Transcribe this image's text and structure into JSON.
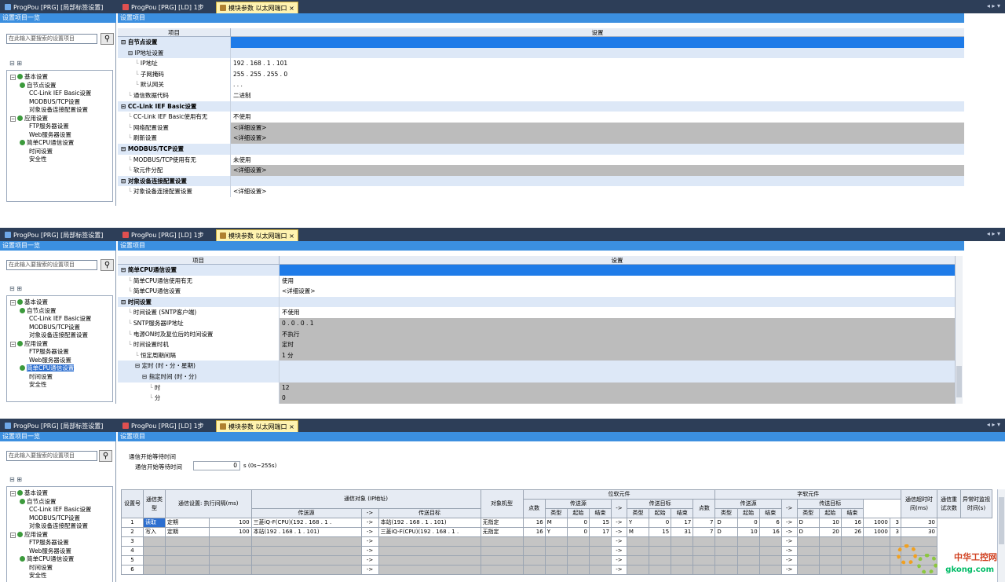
{
  "tabs": [
    {
      "label": "ProgPou [PRG] [局部标签设置]",
      "active": false
    },
    {
      "label": "ProgPou [PRG] [LD] 1步",
      "active": false
    },
    {
      "label": "模块参数 以太网端口",
      "active": true
    }
  ],
  "close_glyph": "×",
  "tab_controls": "◂ ▸ ▾",
  "left_header": "设置项目一览",
  "right_header": "设置项目",
  "search_placeholder": "在此输入要搜索的设置项目",
  "search_icon": "binoculars-icon",
  "toolbar_icons": "⊟ ⊞",
  "col_item": "项目",
  "col_setting": "设置",
  "tree": [
    {
      "label": "基本设置",
      "level": 0,
      "check": true,
      "expand": true
    },
    {
      "label": "自节点设置",
      "level": 1,
      "check": true
    },
    {
      "label": "CC-Link IEF Basic设置",
      "level": 2,
      "check": false
    },
    {
      "label": "MODBUS/TCP设置",
      "level": 2,
      "check": false
    },
    {
      "label": "对象设备连接配置设置",
      "level": 2,
      "check": false
    },
    {
      "label": "应用设置",
      "level": 0,
      "check": true,
      "expand": true
    },
    {
      "label": "FTP服务器设置",
      "level": 2,
      "check": false
    },
    {
      "label": "Web服务器设置",
      "level": 2,
      "check": false
    },
    {
      "label": "简单CPU通信设置",
      "level": 1,
      "check": true
    },
    {
      "label": "时间设置",
      "level": 2,
      "check": false
    },
    {
      "label": "安全性",
      "level": 2,
      "check": false
    }
  ],
  "panel1_rows": [
    {
      "item": "自节点设置",
      "value": "",
      "type": "section-blue",
      "indent": 0
    },
    {
      "item": "IP地址设置",
      "value": "",
      "type": "lb",
      "indent": 1
    },
    {
      "item": "IP地址",
      "value": "192 . 168 .  1 . 101",
      "type": "white",
      "indent": 2
    },
    {
      "item": "子网掩码",
      "value": "255 . 255 . 255 .  0",
      "type": "white",
      "indent": 2
    },
    {
      "item": "默认网关",
      "value": "  .   .   .",
      "type": "white",
      "indent": 2
    },
    {
      "item": "通信数据代码",
      "value": "二进制",
      "type": "white",
      "indent": 1
    },
    {
      "item": "CC-Link IEF Basic设置",
      "value": "",
      "type": "section",
      "indent": 0
    },
    {
      "item": "CC-Link IEF Basic使用有无",
      "value": "不使用",
      "type": "white",
      "indent": 1
    },
    {
      "item": "网络配置设置",
      "value": "<详细设置>",
      "type": "gray",
      "indent": 1
    },
    {
      "item": "刷新设置",
      "value": "<详细设置>",
      "type": "gray",
      "indent": 1
    },
    {
      "item": "MODBUS/TCP设置",
      "value": "",
      "type": "section",
      "indent": 0
    },
    {
      "item": "MODBUS/TCP使用有无",
      "value": "未使用",
      "type": "white",
      "indent": 1
    },
    {
      "item": "软元件分配",
      "value": "<详细设置>",
      "type": "gray",
      "indent": 1
    },
    {
      "item": "对象设备连接配置设置",
      "value": "",
      "type": "section",
      "indent": 0
    },
    {
      "item": "对象设备连接配置设置",
      "value": "<详细设置>",
      "type": "white",
      "indent": 1
    }
  ],
  "panel2_rows": [
    {
      "item": "简单CPU通信设置",
      "value": "",
      "type": "section-blue",
      "indent": 0
    },
    {
      "item": "简单CPU通信使用有无",
      "value": "使用",
      "type": "white",
      "indent": 1
    },
    {
      "item": "简单CPU通信设置",
      "value": "<详细设置>",
      "type": "white",
      "indent": 1
    },
    {
      "item": "时间设置",
      "value": "",
      "type": "section",
      "indent": 0
    },
    {
      "item": "时间设置 (SNTP客户端)",
      "value": "不使用",
      "type": "white",
      "indent": 1
    },
    {
      "item": "SNTP服务器IP地址",
      "value": "  0 .   0 .   0 .   1",
      "type": "gray",
      "indent": 1
    },
    {
      "item": "电源ON时及复位后的时间设置",
      "value": "不执行",
      "type": "gray",
      "indent": 1
    },
    {
      "item": "时间设置时机",
      "value": "定时",
      "type": "gray",
      "indent": 1
    },
    {
      "item": "恒定周期间隔",
      "value": "1 分",
      "type": "gray",
      "indent": 2
    },
    {
      "item": "定时 (时・分・星期)",
      "value": "",
      "type": "lb",
      "indent": 2
    },
    {
      "item": "指定时间 (时・分)",
      "value": "",
      "type": "lb",
      "indent": 3
    },
    {
      "item": "时",
      "value": "12",
      "type": "gray",
      "indent": 4
    },
    {
      "item": "分",
      "value": "0",
      "type": "gray",
      "indent": 4
    }
  ],
  "panel3": {
    "wait_title": "通信开始等待时间",
    "wait_label": "通信开始等待时间",
    "wait_value": "0",
    "wait_unit": "s (0s~255s)",
    "h_no": "设置号",
    "h_type": "通信类型",
    "h_exec": "通信设置: 执行间隔(ms)",
    "h_target": "通信对象 (IP地址)",
    "h_src": "传送源",
    "h_arrow": "->",
    "h_dst": "传送目标",
    "h_model": "对象机型",
    "h_bit": "位软元件",
    "h_word": "字软元件",
    "h_pts": "点数",
    "h_kind": "类型",
    "h_start": "起始",
    "h_end": "结束",
    "h_timeout": "通信超时时间(ms)",
    "h_retry": "通信重试次数",
    "h_abn": "异常时监视时间(s)",
    "rows": [
      {
        "no": "1",
        "type": "读取",
        "mode": "定期",
        "interval": "100",
        "src": "三菱iQ-F(CPU)(192 . 168 . 1 .",
        "dst": "本站(192 . 168 . 1 . 101)",
        "model": "无指定",
        "bpts": "16",
        "bsk": "M",
        "bss": "0",
        "bse": "15",
        "bdk": "Y",
        "bds": "0",
        "bde": "17",
        "wpts": "7",
        "wsk": "D",
        "wss": "0",
        "wse": "6",
        "wdk": "D",
        "wds": "10",
        "wde": "16",
        "to": "1000",
        "rt": "3",
        "ab": "30"
      },
      {
        "no": "2",
        "type": "写入",
        "mode": "定期",
        "interval": "100",
        "src": "本站(192 . 168 . 1 . 101)",
        "dst": "三菱iQ-F(CPU)(192 . 168 . 1 .",
        "model": "无指定",
        "bpts": "16",
        "bsk": "Y",
        "bss": "0",
        "bse": "17",
        "bdk": "M",
        "bds": "15",
        "bde": "31",
        "wpts": "7",
        "wsk": "D",
        "wss": "10",
        "wse": "16",
        "wdk": "D",
        "wds": "20",
        "wde": "26",
        "to": "1000",
        "rt": "3",
        "ab": "30"
      },
      {
        "no": "3"
      },
      {
        "no": "4"
      },
      {
        "no": "5"
      },
      {
        "no": "6"
      }
    ]
  },
  "watermark": "中华工控网",
  "watermark_url": "gkong.com"
}
